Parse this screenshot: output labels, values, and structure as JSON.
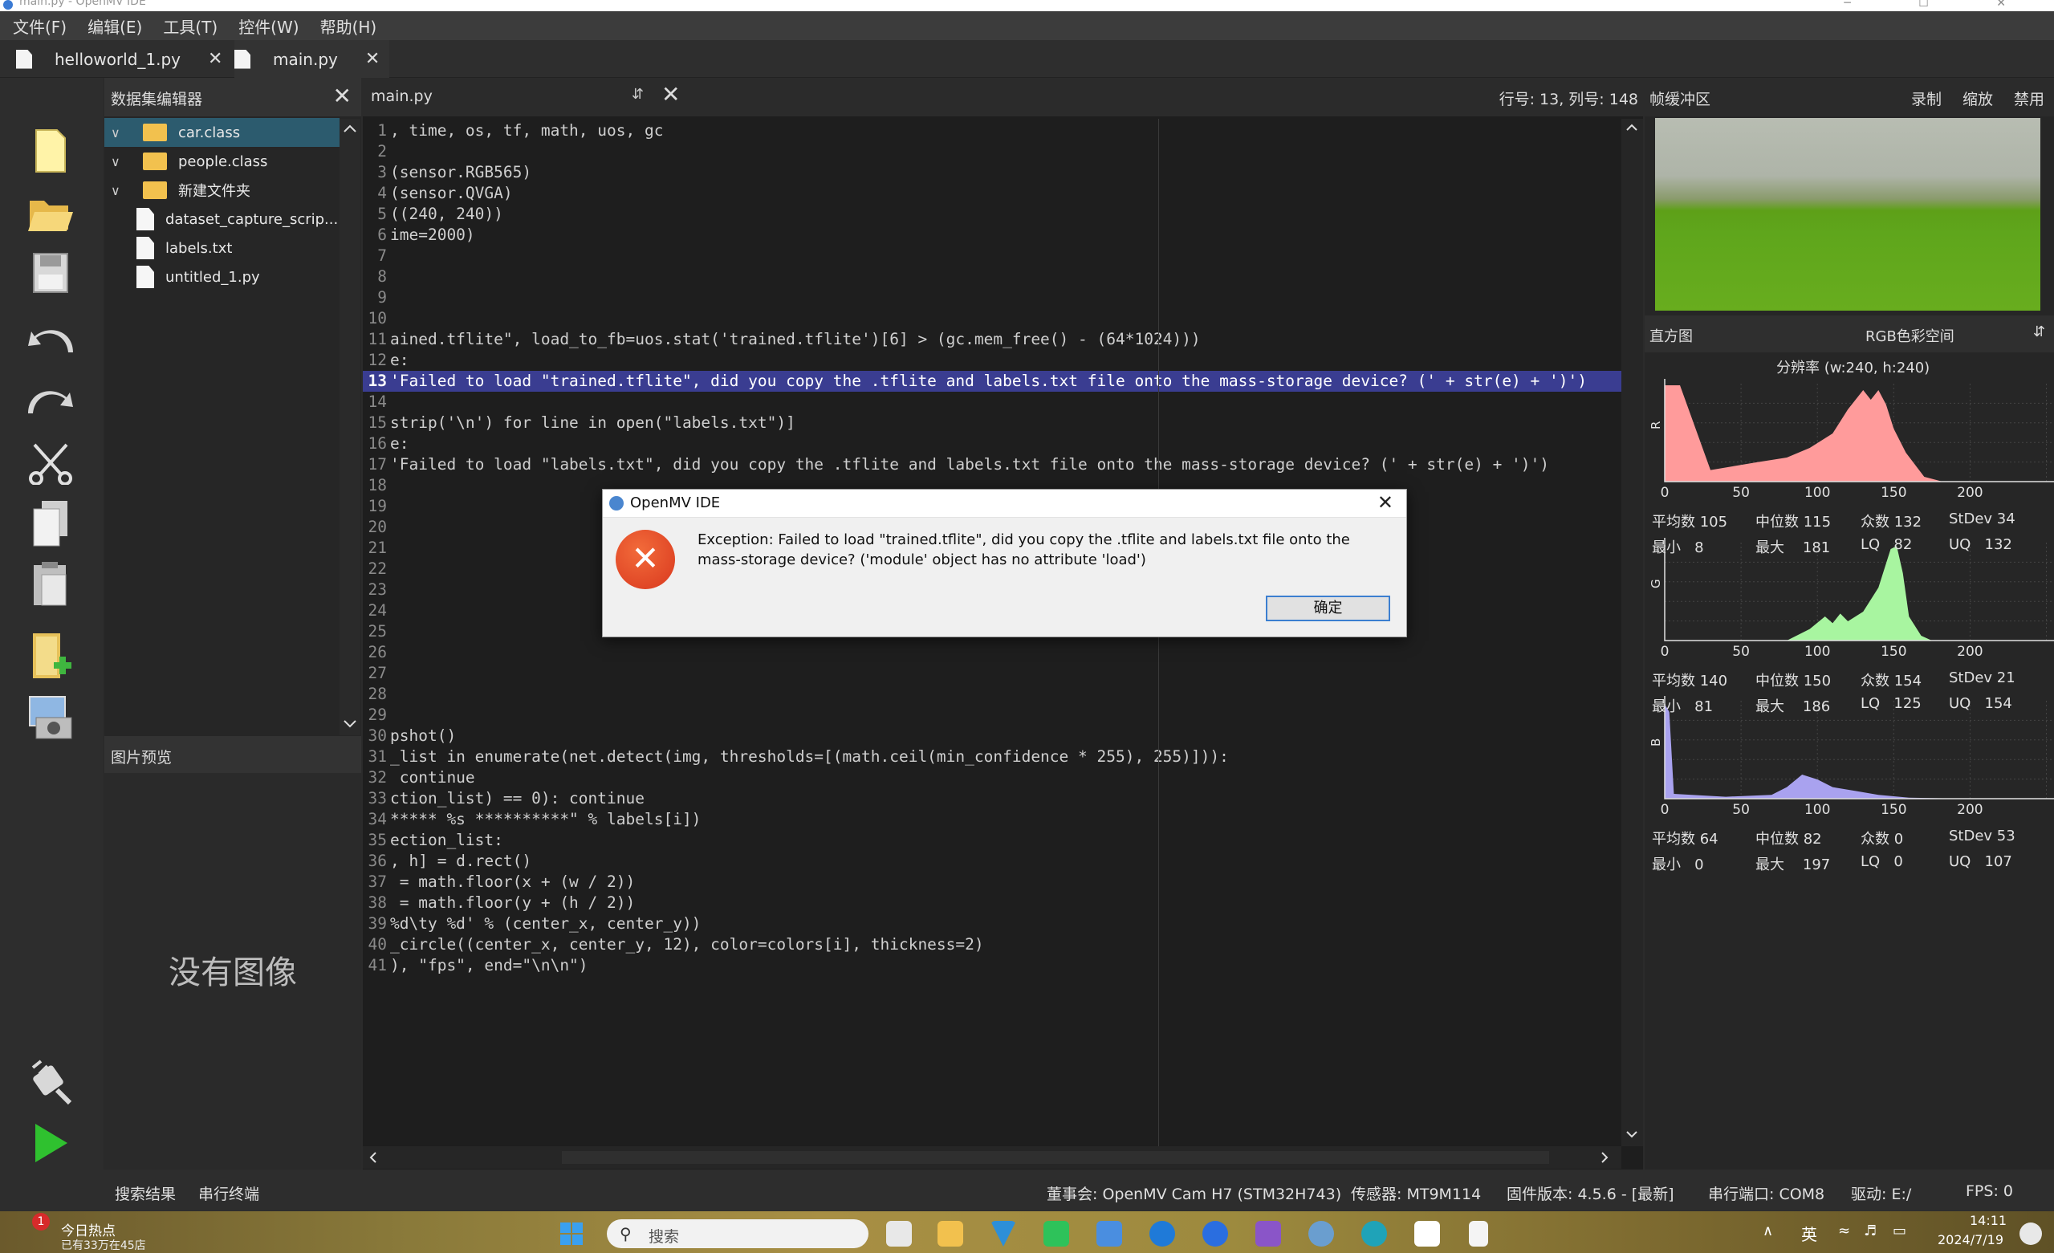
{
  "window": {
    "title": "main.py - OpenMV IDE",
    "controls": "─ ☐ ✕"
  },
  "menu": [
    "文件(F)",
    "编辑(E)",
    "工具(T)",
    "控件(W)",
    "帮助(H)"
  ],
  "file_tabs": [
    {
      "label": "helloworld_1.py",
      "close": "✕"
    },
    {
      "label": "main.py",
      "close": "✕"
    }
  ],
  "dataset_panel": {
    "title": "数据集编辑器",
    "close": "✕",
    "items": [
      {
        "label": "car.class",
        "type": "folder"
      },
      {
        "label": "people.class",
        "type": "folder"
      },
      {
        "label": "新建文件夹",
        "type": "folder"
      },
      {
        "label": "dataset_capture_scrip...",
        "type": "file"
      },
      {
        "label": "labels.txt",
        "type": "file"
      },
      {
        "label": "untitled_1.py",
        "type": "file"
      }
    ]
  },
  "image_preview": {
    "title": "图片预览",
    "empty_text": "没有图像"
  },
  "editor": {
    "filename": "main.py",
    "cursor_position": "行号: 13, 列号: 148",
    "highlighted_line": 13,
    "lines": [
      ", time, os, tf, math, uos, gc",
      "",
      "(sensor.RGB565)",
      "(sensor.QVGA)",
      "((240, 240))",
      "ime=2000)",
      "",
      "",
      "",
      "",
      "ained.tflite\", load_to_fb=uos.stat('trained.tflite')[6] > (gc.mem_free() - (64*1024)))",
      "e:",
      "'Failed to load \"trained.tflite\", did you copy the .tflite and labels.txt file onto the mass-storage device? (' + str(e) + ')')",
      "",
      "strip('\\n') for line in open(\"labels.txt\")]",
      "e:",
      "'Failed to load \"labels.txt\", did you copy the .tflite and labels.txt file onto the mass-storage device? (' + str(e) + ')')",
      "",
      "",
      "",
      "",
      "",
      "",
      "",
      "",
      "",
      "",
      "",
      "",
      "pshot()",
      "_list in enumerate(net.detect(img, thresholds=[(math.ceil(min_confidence * 255), 255)])):",
      " continue",
      "ction_list) == 0): continue",
      "***** %s **********\" % labels[i])",
      "ection_list:",
      ", h] = d.rect()",
      " = math.floor(x + (w / 2))",
      " = math.floor(y + (h / 2))",
      "%d\\ty %d' % (center_x, center_y))",
      "_circle((center_x, center_y, 12), color=colors[i], thickness=2)",
      "), \"fps\", end=\"\\n\\n\")"
    ]
  },
  "frame_buffer": {
    "title": "帧缓冲区",
    "actions": [
      "录制",
      "缩放",
      "禁用"
    ]
  },
  "histogram": {
    "title": "直方图",
    "color_space": "RGB色彩空间",
    "resolution": "分辨率 (w:240, h:240)",
    "x_ticks": [
      "0",
      "50",
      "100",
      "150",
      "200"
    ],
    "channels": [
      {
        "name": "R",
        "color": "#ff9b9b",
        "stats": {
          "mean_label": "平均数",
          "mean": "105",
          "median_label": "中位数",
          "median": "115",
          "mode_label": "众数",
          "mode": "132",
          "stdev_label": "StDev",
          "stdev": "34",
          "min_label": "最小",
          "min": "8",
          "max_label": "最大",
          "max": "181",
          "lq_label": "LQ",
          "lq": "82",
          "uq_label": "UQ",
          "uq": "132"
        }
      },
      {
        "name": "G",
        "color": "#a8f5a0",
        "stats": {
          "mean_label": "平均数",
          "mean": "140",
          "median_label": "中位数",
          "median": "150",
          "mode_label": "众数",
          "mode": "154",
          "stdev_label": "StDev",
          "stdev": "21",
          "min_label": "最小",
          "min": "81",
          "max_label": "最大",
          "max": "186",
          "lq_label": "LQ",
          "lq": "125",
          "uq_label": "UQ",
          "uq": "154"
        }
      },
      {
        "name": "B",
        "color": "#a9a2ef",
        "stats": {
          "mean_label": "平均数",
          "mean": "64",
          "median_label": "中位数",
          "median": "82",
          "mode_label": "众数",
          "mode": "0",
          "stdev_label": "StDev",
          "stdev": "53",
          "min_label": "最小",
          "min": "0",
          "max_label": "最大",
          "max": "197",
          "lq_label": "LQ",
          "lq": "0",
          "uq_label": "UQ",
          "uq": "107"
        }
      }
    ]
  },
  "dialog": {
    "title": "OpenMV IDE",
    "close": "✕",
    "icon": "error-icon",
    "message": "Exception: Failed to load \"trained.tflite\", did you copy the .tflite and labels.txt file onto the mass-storage device? ('module' object has no attribute 'load')",
    "ok_label": "确定"
  },
  "status_bar": {
    "tabs": [
      "搜索结果",
      "串行终端"
    ],
    "board": "董事会: OpenMV Cam H7 (STM32H743)",
    "sensor": "传感器: MT9M114",
    "firmware": "固件版本: 4.5.6 - [最新]",
    "serial_port": "串行端口: COM8",
    "drive": "驱动: E:/",
    "fps": "FPS: 0"
  },
  "taskbar": {
    "news_badge": "1",
    "news_title": "今日热点",
    "news_sub": "已有33万在45店",
    "search_placeholder": "搜索",
    "ime": "英",
    "time": "14:11",
    "date": "2024/7/19"
  }
}
